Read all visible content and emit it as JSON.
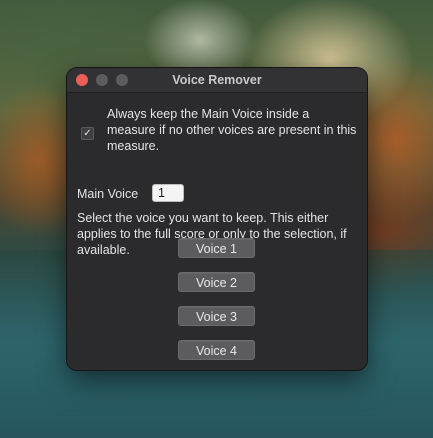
{
  "window": {
    "title": "Voice Remover"
  },
  "options": {
    "keep_main_voice": {
      "checked": true,
      "check_glyph": "✓",
      "label": "Always keep the Main Voice inside a measure if no other voices are present in this measure."
    },
    "main_voice": {
      "label": "Main Voice",
      "value": "1"
    }
  },
  "instructions": "Select the voice you want to keep. This either applies to the full score or only to the selection, if available.",
  "buttons": {
    "voice1": "Voice 1",
    "voice2": "Voice 2",
    "voice3": "Voice 3",
    "voice4": "Voice 4"
  },
  "colors": {
    "window_bg": "#2b2b2d",
    "close_light": "#ec5f57",
    "inactive_light": "#5c5c5f",
    "button_bg": "#5c5c5f"
  }
}
